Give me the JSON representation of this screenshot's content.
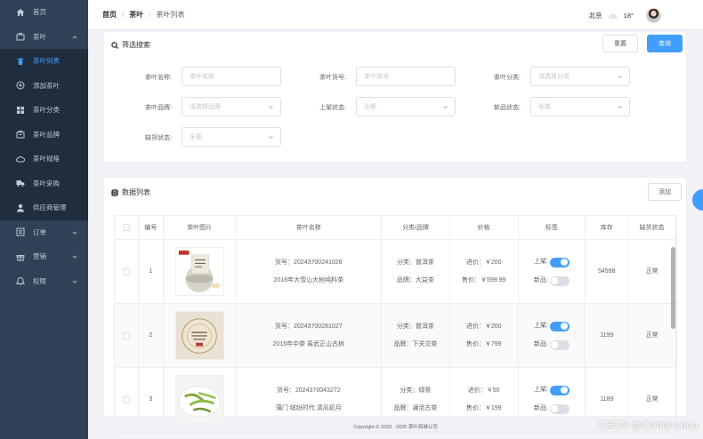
{
  "sidebar": {
    "items": [
      {
        "label": "首页",
        "icon": "home-icon",
        "expandable": false
      },
      {
        "label": "茶叶",
        "icon": "bag-icon",
        "expandable": true
      },
      {
        "label": "茶叶列表",
        "icon": "trash-icon",
        "sub": true,
        "active": true
      },
      {
        "label": "添加茶叶",
        "icon": "plus-circle-icon",
        "sub": true
      },
      {
        "label": "茶叶分类",
        "icon": "grid-icon",
        "sub": true
      },
      {
        "label": "茶叶品牌",
        "icon": "shop-icon",
        "sub": true
      },
      {
        "label": "茶叶规格",
        "icon": "cloud-icon",
        "sub": true
      },
      {
        "label": "茶叶采购",
        "icon": "truck-icon",
        "sub": true
      },
      {
        "label": "供应商管理",
        "icon": "user-icon",
        "sub": true
      },
      {
        "label": "订单",
        "icon": "list-icon",
        "expandable": true
      },
      {
        "label": "营销",
        "icon": "gift-icon",
        "expandable": true
      },
      {
        "label": "权限",
        "icon": "bell-icon",
        "expandable": true
      }
    ]
  },
  "header": {
    "breadcrumb": [
      "首页",
      "茶叶",
      "茶叶列表"
    ],
    "city": "北京",
    "temperature": "18°"
  },
  "filter": {
    "title": "筛选搜索",
    "reset_label": "重置",
    "search_label": "查询",
    "fields": [
      {
        "label": "茶叶名称:",
        "placeholder": "茶叶名称",
        "type": "input"
      },
      {
        "label": "茶叶货号:",
        "placeholder": "茶叶货号",
        "type": "input"
      },
      {
        "label": "茶叶分类:",
        "placeholder": "请选择分类",
        "type": "select"
      },
      {
        "label": "茶叶品牌:",
        "placeholder": "请选择品牌",
        "type": "select"
      },
      {
        "label": "上架状态:",
        "placeholder": "全部",
        "type": "select"
      },
      {
        "label": "新品状态:",
        "placeholder": "全部",
        "type": "select"
      },
      {
        "label": "缺货状态:",
        "placeholder": "全部",
        "type": "select"
      }
    ]
  },
  "list": {
    "title": "数据列表",
    "add_label": "添加",
    "columns": [
      "编号",
      "茶叶图片",
      "茶叶名称",
      "分类/品牌",
      "价格",
      "标签",
      "库存",
      "缺货状态"
    ],
    "rows": [
      {
        "no": "1",
        "code": "货号：20243700241026",
        "name": "2018年大雪山大树纯料茶",
        "category": "分类：普洱茶",
        "brand": "品牌：大益茶",
        "cost": "进价：￥200",
        "price": "售价：￥599.99",
        "onsale": true,
        "isnew": false,
        "stock": "54598",
        "status": "正常",
        "on_label": "上架:",
        "new_label": "新品:"
      },
      {
        "no": "2",
        "code": "货号：20243700281027",
        "name": "2015年中茶 易武正山古树",
        "category": "分类：普洱茶",
        "brand": "品牌：下关沱茶",
        "cost": "进价：￥200",
        "price": "售价：￥799",
        "onsale": true,
        "isnew": false,
        "stock": "1199",
        "status": "正常",
        "on_label": "上架:",
        "new_label": "新品:"
      },
      {
        "no": "3",
        "code": "货号：2024370043272",
        "name": "蒲门 缤纷时代 清风初月",
        "category": "分类：绿茶",
        "brand": "品牌：澜沧古茶",
        "cost": "进价：￥50",
        "price": "售价：￥199",
        "onsale": true,
        "isnew": false,
        "stock": "1189",
        "status": "正常",
        "on_label": "上架:",
        "new_label": "新品:"
      }
    ]
  },
  "footer": "Copyright © 2020 - 2025  茶叶商城公司",
  "watermark": "CSDN @Coder-coco",
  "colors": {
    "sidebar": "#304156",
    "accent": "#409eff"
  }
}
